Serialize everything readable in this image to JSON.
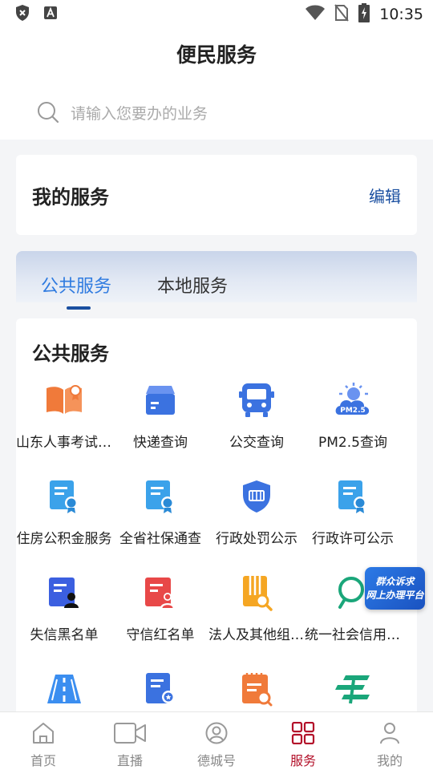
{
  "status_bar": {
    "time": "10:35",
    "icons": [
      "shield-x-icon",
      "accessibility-icon",
      "wifi-icon",
      "no-sim-icon",
      "battery-charging-icon"
    ]
  },
  "header": {
    "title": "便民服务"
  },
  "search": {
    "placeholder": "请输入您要办的业务",
    "icon": "search-icon"
  },
  "my_services": {
    "title": "我的服务",
    "edit_label": "编辑"
  },
  "tabs": [
    {
      "label": "公共服务",
      "active": true
    },
    {
      "label": "本地服务",
      "active": false
    }
  ],
  "section": {
    "title": "公共服务",
    "items": [
      {
        "label": "山东人事考试信息网",
        "icon": "open-book-icon"
      },
      {
        "label": "快递查询",
        "icon": "package-box-icon"
      },
      {
        "label": "公交查询",
        "icon": "bus-icon"
      },
      {
        "label": "PM2.5查询",
        "icon": "pm25-weather-icon"
      },
      {
        "label": "住房公积金服务",
        "icon": "certificate-doc-icon"
      },
      {
        "label": "全省社保通查",
        "icon": "certificate-doc-icon"
      },
      {
        "label": "行政处罚公示",
        "icon": "penalty-shield-icon"
      },
      {
        "label": "行政许可公示",
        "icon": "certificate-doc-icon"
      },
      {
        "label": "失信黑名单",
        "icon": "blacklist-doc-icon"
      },
      {
        "label": "守信红名单",
        "icon": "redlist-doc-icon"
      },
      {
        "label": "法人及其他组织信息",
        "icon": "document-search-icon"
      },
      {
        "label": "统一社会信用代码",
        "icon": "credit-code-icon"
      },
      {
        "label": "",
        "icon": "road-icon"
      },
      {
        "label": "",
        "icon": "badge-doc-icon"
      },
      {
        "label": "",
        "icon": "calendar-search-icon"
      },
      {
        "label": "",
        "icon": "china-post-icon"
      }
    ]
  },
  "float_badge": {
    "line1": "群众诉求",
    "line2": "网上办理平台"
  },
  "bottom_nav": [
    {
      "label": "首页",
      "icon": "home-icon",
      "active": false
    },
    {
      "label": "直播",
      "icon": "video-camera-icon",
      "active": false
    },
    {
      "label": "德城号",
      "icon": "account-circle-icon",
      "active": false
    },
    {
      "label": "服务",
      "icon": "services-grid-icon",
      "active": true
    },
    {
      "label": "我的",
      "icon": "user-icon",
      "active": false
    }
  ],
  "colors": {
    "accent": "#1a4fa0",
    "tab_active": "#2f7be0",
    "nav_active": "#b3112a",
    "icon_blue": "#3b72e0",
    "icon_orange": "#f07a3a",
    "icon_red": "#e84848",
    "icon_yellow": "#f5a623",
    "icon_green": "#1aa67a"
  }
}
